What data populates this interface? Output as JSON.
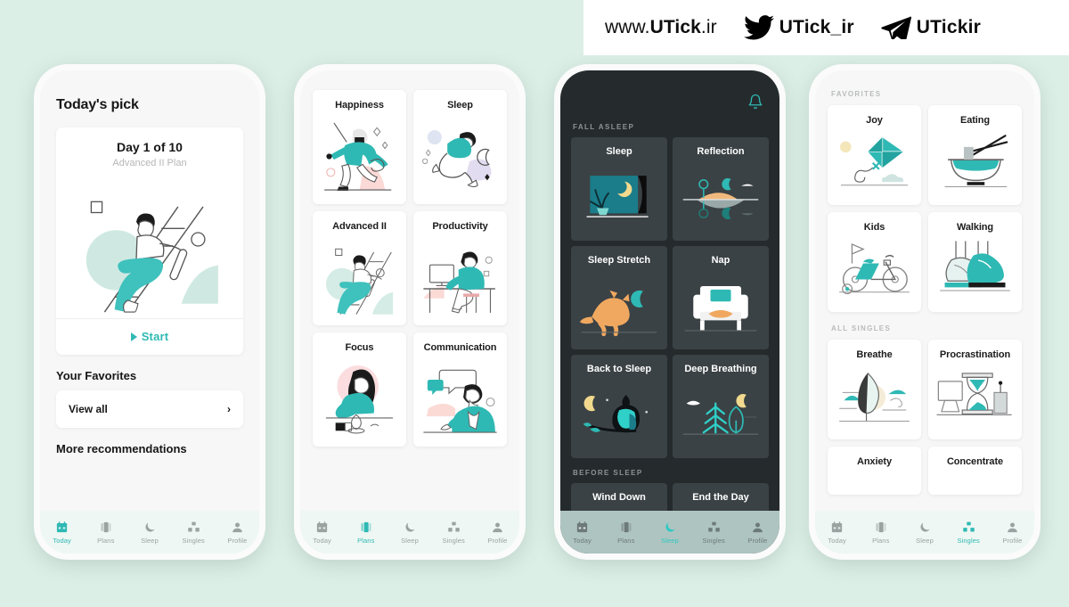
{
  "banner": {
    "website": "www.UTick.ir",
    "website_prefix": "www.",
    "website_brand": "UTick",
    "website_tld": ".ir",
    "twitter_handle": "UTick_ir",
    "telegram_handle": "UTickir",
    "twitter_icon": "twitter-bird-icon",
    "telegram_icon": "telegram-plane-icon",
    "background": "#ffffff"
  },
  "theme": {
    "page_background": "#dcefe7",
    "accent_teal": "#2fb9b4",
    "dark_screen_bg": "#252b2d",
    "dark_card_bg": "#3b4245",
    "light_screen_bg": "#f7f7f7"
  },
  "phone1": {
    "name": "today-screen",
    "title": "Today's pick",
    "pick_card": {
      "day": "Day 1 of 10",
      "plan": "Advanced II Plan",
      "start_label": "Start",
      "art": "person-climbing-ladder-illustration"
    },
    "favorites_title": "Your Favorites",
    "view_all_label": "View all",
    "more_title": "More recommendations",
    "tabs": [
      {
        "label": "Today",
        "icon": "calendar-icon",
        "active": true
      },
      {
        "label": "Plans",
        "icon": "cards-icon",
        "active": false
      },
      {
        "label": "Sleep",
        "icon": "moon-icon",
        "active": false
      },
      {
        "label": "Singles",
        "icon": "blocks-icon",
        "active": false
      },
      {
        "label": "Profile",
        "icon": "person-icon",
        "active": false
      }
    ]
  },
  "phone2": {
    "name": "plans-screen",
    "tiles": [
      {
        "label": "Happiness",
        "art": "dancing-person-illustration"
      },
      {
        "label": "Sleep",
        "art": "sleeping-person-moon-illustration"
      },
      {
        "label": "Advanced II",
        "art": "person-climbing-ladder-illustration"
      },
      {
        "label": "Productivity",
        "art": "person-at-desk-illustration"
      },
      {
        "label": "Focus",
        "art": "person-reading-illustration"
      },
      {
        "label": "Communication",
        "art": "person-speech-bubble-illustration"
      }
    ],
    "tabs": [
      {
        "label": "Today",
        "icon": "calendar-icon",
        "active": false
      },
      {
        "label": "Plans",
        "icon": "cards-icon",
        "active": true
      },
      {
        "label": "Sleep",
        "icon": "moon-icon",
        "active": false
      },
      {
        "label": "Singles",
        "icon": "blocks-icon",
        "active": false
      },
      {
        "label": "Profile",
        "icon": "person-icon",
        "active": false
      }
    ]
  },
  "phone3": {
    "name": "sleep-screen",
    "bell_icon": "notification-bell-icon",
    "sections": [
      {
        "caption": "FALL ASLEEP",
        "tiles": [
          {
            "label": "Sleep",
            "art": "window-moon-plant-illustration"
          },
          {
            "label": "Reflection",
            "art": "island-reflection-illustration"
          },
          {
            "label": "Sleep Stretch",
            "art": "stretching-cat-moon-illustration"
          },
          {
            "label": "Nap",
            "art": "armchair-cat-illustration"
          },
          {
            "label": "Back to Sleep",
            "art": "owl-on-branch-moon-illustration"
          },
          {
            "label": "Deep Breathing",
            "art": "pine-trees-moon-illustration"
          }
        ]
      },
      {
        "caption": "BEFORE SLEEP",
        "tiles": [
          {
            "label": "Wind Down",
            "art": ""
          },
          {
            "label": "End the Day",
            "art": ""
          }
        ]
      }
    ],
    "tabs": [
      {
        "label": "Today",
        "icon": "calendar-icon",
        "active": false
      },
      {
        "label": "Plans",
        "icon": "cards-icon",
        "active": false
      },
      {
        "label": "Sleep",
        "icon": "moon-icon",
        "active": true
      },
      {
        "label": "Singles",
        "icon": "blocks-icon",
        "active": false
      },
      {
        "label": "Profile",
        "icon": "person-icon",
        "active": false
      }
    ]
  },
  "phone4": {
    "name": "singles-screen",
    "sections": [
      {
        "caption": "FAVORITES",
        "tiles": [
          {
            "label": "Joy",
            "art": "kite-sun-cloud-illustration"
          },
          {
            "label": "Eating",
            "art": "bowl-chopsticks-illustration"
          },
          {
            "label": "Kids",
            "art": "childrens-bicycle-illustration"
          },
          {
            "label": "Walking",
            "art": "walking-sneakers-illustration"
          }
        ]
      },
      {
        "caption": "ALL SINGLES",
        "tiles": [
          {
            "label": "Breathe",
            "art": "leaf-hills-illustration"
          },
          {
            "label": "Procrastination",
            "art": "hourglass-desk-illustration"
          },
          {
            "label": "Anxiety",
            "art": ""
          },
          {
            "label": "Concentrate",
            "art": ""
          }
        ]
      }
    ],
    "tabs": [
      {
        "label": "Today",
        "icon": "calendar-icon",
        "active": false
      },
      {
        "label": "Plans",
        "icon": "cards-icon",
        "active": false
      },
      {
        "label": "Sleep",
        "icon": "moon-icon",
        "active": false
      },
      {
        "label": "Singles",
        "icon": "blocks-icon",
        "active": true
      },
      {
        "label": "Profile",
        "icon": "person-icon",
        "active": false
      }
    ]
  }
}
